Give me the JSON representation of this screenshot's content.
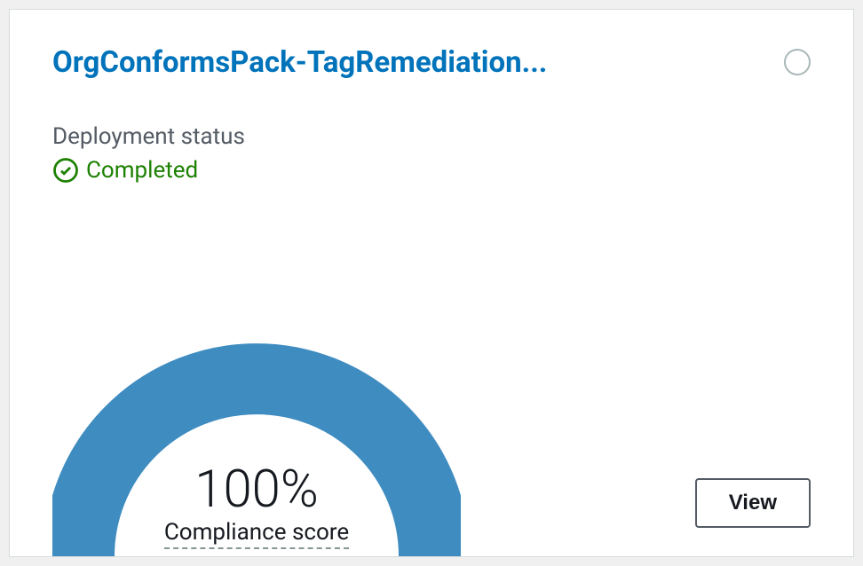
{
  "card": {
    "title": "OrgConformsPack-TagRemediation...",
    "status_label": "Deployment status",
    "status_value": "Completed",
    "view_button": "View"
  },
  "chart_data": {
    "type": "gauge",
    "value": 100,
    "display_value": "100%",
    "label": "Compliance score",
    "range": [
      0,
      100
    ],
    "color": "#3f8cc1"
  }
}
